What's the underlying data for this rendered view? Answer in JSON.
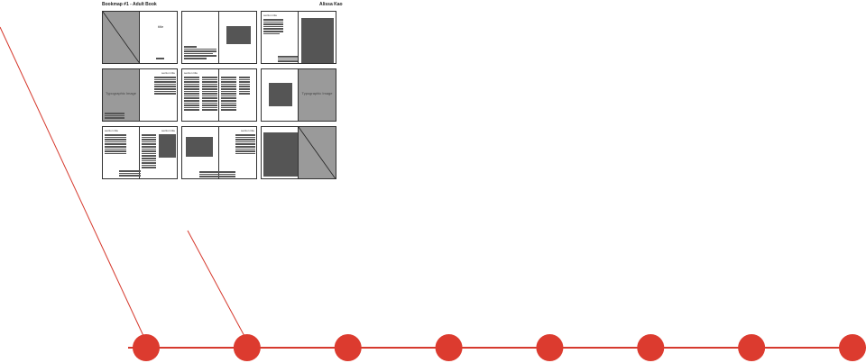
{
  "header": {
    "left_title": "Bookmap #1 - Adult Book",
    "right_title": "Alissa Kao"
  },
  "spreads": {
    "title_text": "title",
    "section_title": "section title",
    "typographic_image": "Typographic Image"
  },
  "timeline": {
    "node_count": 8,
    "node_color": "#dc3b2f",
    "line_color": "#dc3b2f"
  }
}
